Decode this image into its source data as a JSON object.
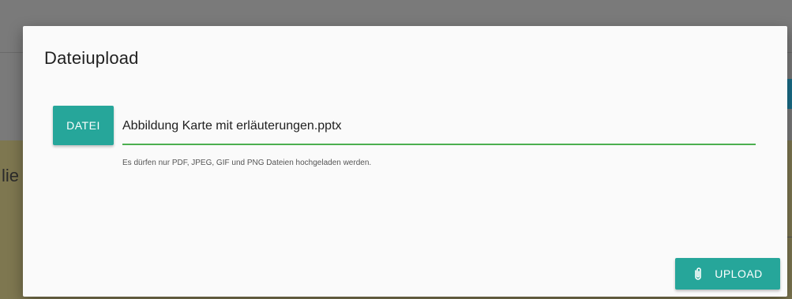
{
  "background": {
    "fragment_text": "lie"
  },
  "dialog": {
    "title": "Dateiupload",
    "file_button_label": "DATEI",
    "file_path_value": "Abbildung Karte mit erläuterungen.pptx",
    "hint": "Es dürfen nur PDF, JPEG, GIF und PNG Dateien hochgeladen werden.",
    "upload_button_label": "UPLOAD",
    "upload_icon": "paperclip-icon"
  },
  "colors": {
    "accent": "#26a69a",
    "input_underline": "#4caf50"
  }
}
